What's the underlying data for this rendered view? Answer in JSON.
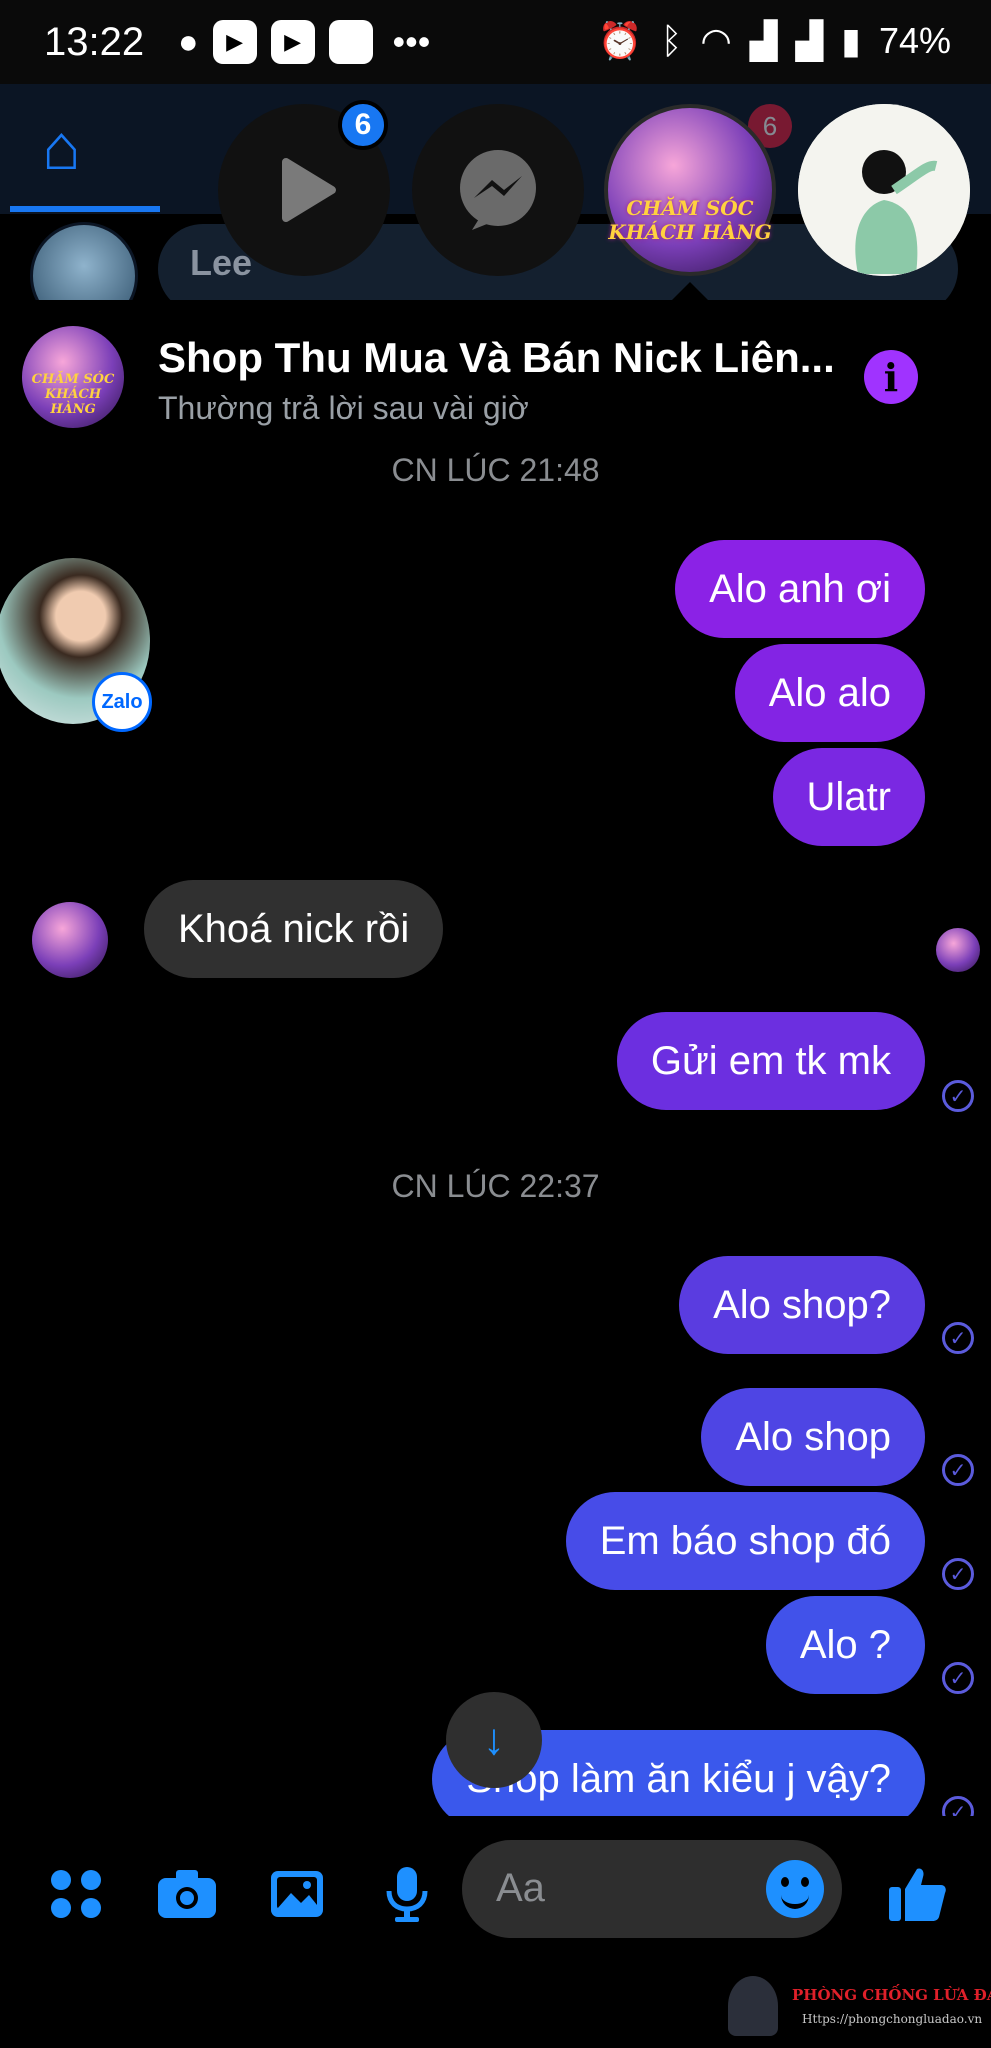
{
  "status_bar": {
    "time": "13:22",
    "battery": "74%",
    "icons": [
      "chat-bubble-icon",
      "video-app-icon",
      "video-app-icon",
      "app-icon",
      "more-icon",
      "alarm-icon",
      "bluetooth-icon",
      "wifi-icon",
      "signal-icon",
      "signal-icon",
      "battery-icon"
    ]
  },
  "background": {
    "post_name": "Lee"
  },
  "chat_heads": {
    "video_badge": "6",
    "other_badge": "6",
    "shop_logo_line1": "CHĂM SÓC",
    "shop_logo_line2": "KHÁCH HÀNG"
  },
  "conversation": {
    "title": "Shop Thu Mua Và Bán Nick Liên...",
    "subtitle": "Thường trả lời sau vài giờ",
    "avatar_logo_line1": "CHĂM SÓC",
    "avatar_logo_line2": "KHÁCH HÀNG"
  },
  "messages": {
    "timestamp1": "CN LÚC 21:48",
    "m1": "Alo anh ơi",
    "m2": "Alo alo",
    "m3": "Ulatr",
    "r1": "Khoá nick rồi",
    "m4": "Gửi em tk mk",
    "timestamp2": "CN LÚC 22:37",
    "m5": "Alo shop?",
    "m6": "Alo shop",
    "m7": "Em báo shop đó",
    "m8": "Alo ?",
    "m9": "Shop làm ăn kiểu j vậy?",
    "zalo_label": "Zalo"
  },
  "composer": {
    "placeholder": "Aa"
  },
  "watermark": {
    "title": "PHÒNG CHỐNG LỪA ĐẢO",
    "url": "Https://phongchongluadao.vn"
  },
  "colors": {
    "accent": "#1e90ff",
    "bubble_purple": "#8a2be2",
    "bubble_blue": "#4b4ee8",
    "incoming": "#303030"
  }
}
